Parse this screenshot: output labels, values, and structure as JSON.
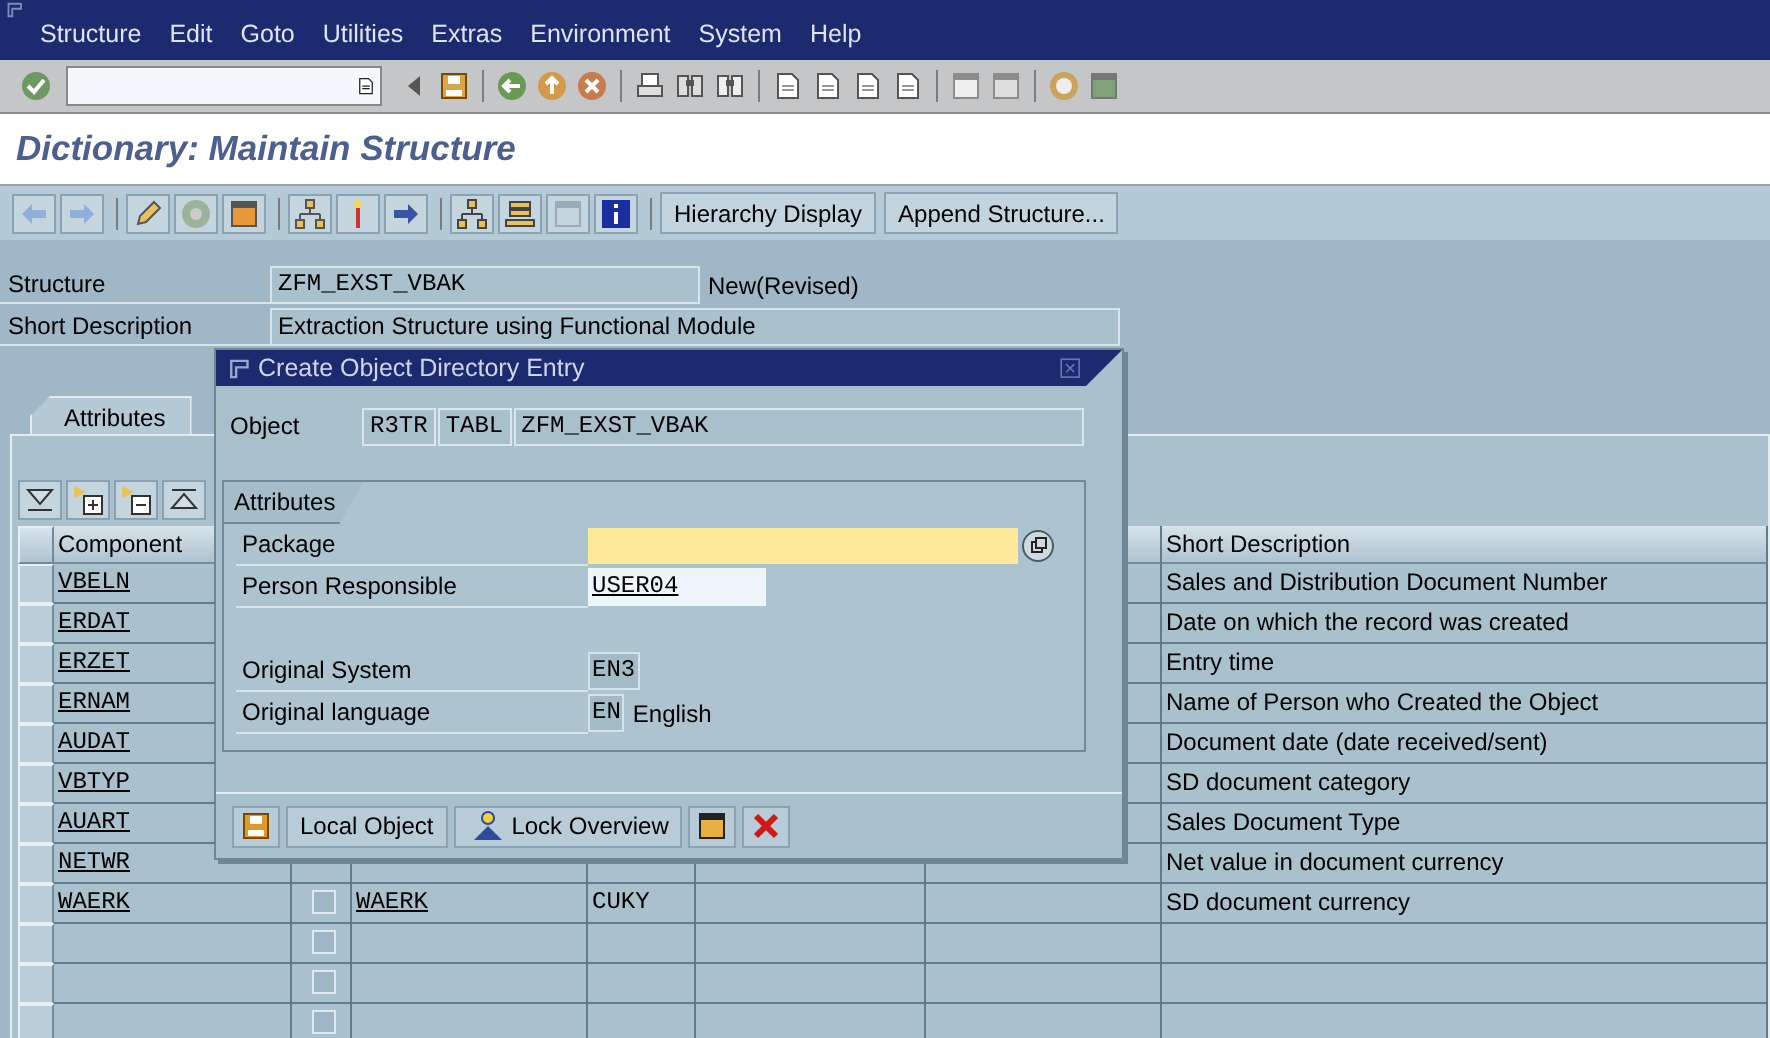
{
  "menu": [
    {
      "label": "Structure"
    },
    {
      "label": "Edit"
    },
    {
      "label": "Goto"
    },
    {
      "label": "Utilities"
    },
    {
      "label": "Extras"
    },
    {
      "label": "Environment"
    },
    {
      "label": "System"
    },
    {
      "label": "Help"
    }
  ],
  "title": "Dictionary: Maintain Structure",
  "app_toolbar": {
    "buttons": [
      "Hierarchy Display",
      "Append Structure..."
    ]
  },
  "header_fields": [
    {
      "label": "Structure",
      "value": "ZFM_EXST_VBAK",
      "status": "New(Revised)"
    },
    {
      "label": "Short Description",
      "value": "Extraction Structure using Functional Module"
    }
  ],
  "tabs": [
    {
      "label": "Attributes",
      "selected": true
    }
  ],
  "table": {
    "columns": [
      "Component",
      "Short Description"
    ],
    "rows": [
      {
        "component": "VBELN",
        "short_description": "Sales and Distribution Document Number"
      },
      {
        "component": "ERDAT",
        "short_description": "Date on which the record was created"
      },
      {
        "component": "ERZET",
        "short_description": "Entry time"
      },
      {
        "component": "ERNAM",
        "short_description": "Name of Person who Created the Object"
      },
      {
        "component": "AUDAT",
        "short_description": "Document date (date received/sent)"
      },
      {
        "component": "VBTYP",
        "short_description": "SD document category"
      },
      {
        "component": "AUART",
        "short_description": "Sales Document Type"
      },
      {
        "component": "NETWR",
        "short_description": "Net value in document currency"
      },
      {
        "component": "WAERK",
        "checked": false,
        "data_element": "WAERK",
        "data_type": "CUKY",
        "short_description": "SD document currency"
      },
      {
        "checked": false
      },
      {
        "checked": false
      },
      {
        "checked": false
      }
    ]
  },
  "dialog": {
    "title": "Create Object Directory Entry",
    "object": {
      "label": "Object",
      "values": [
        "R3TR",
        "TABL",
        "ZFM_EXST_VBAK"
      ]
    },
    "group_title": "Attributes",
    "fields": [
      {
        "label": "Package",
        "kind": "required"
      },
      {
        "label": "Person Responsible",
        "kind": "input",
        "value": "USER04"
      },
      {
        "label": "Original System",
        "kind": "display",
        "value": "EN3"
      },
      {
        "label": "Original language",
        "kind": "display",
        "value": "EN",
        "text": "English"
      }
    ],
    "buttons": [
      "Local Object",
      "Lock Overview"
    ]
  }
}
